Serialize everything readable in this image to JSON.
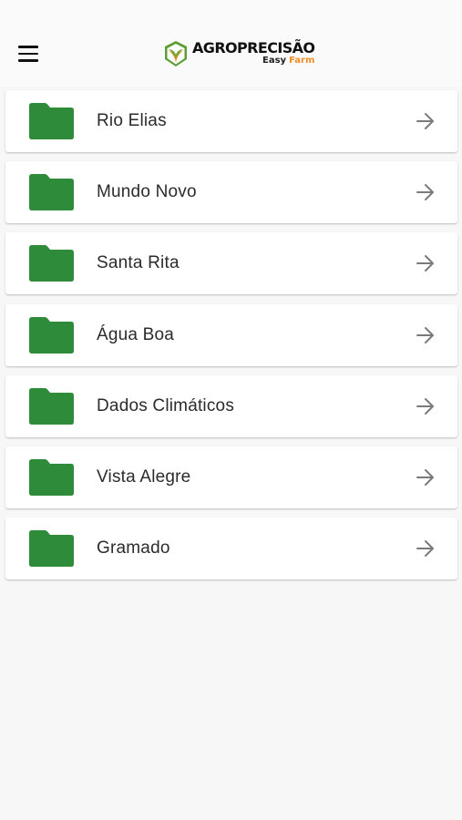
{
  "app_bar": {
    "menu_icon": "hamburger-menu-icon",
    "logo": {
      "title": "AGROPRECISÃO",
      "subtitle_easy": "Easy",
      "subtitle_farm": "Farm",
      "colors": {
        "green": "#6aaa3a",
        "orange": "#f28c28"
      }
    }
  },
  "folders": {
    "icon": "folder-icon",
    "arrow_icon": "arrow-right-icon",
    "color": "#2e8b3a",
    "items": [
      {
        "label": "Rio Elias"
      },
      {
        "label": "Mundo Novo"
      },
      {
        "label": "Santa Rita"
      },
      {
        "label": "Água Boa"
      },
      {
        "label": "Dados Climáticos"
      },
      {
        "label": "Vista Alegre"
      },
      {
        "label": "Gramado"
      }
    ]
  }
}
